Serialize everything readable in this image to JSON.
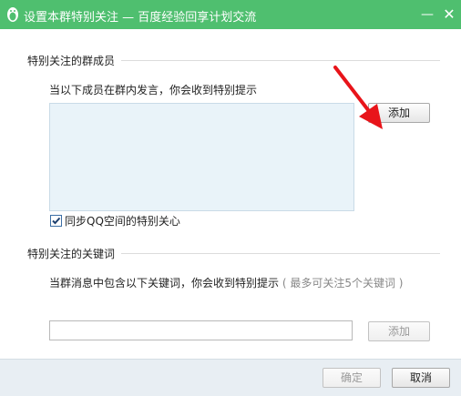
{
  "window": {
    "title": "设置本群特别关注 — 百度经验回享计划交流",
    "minimize_glyph": "—",
    "close_glyph": "✕"
  },
  "members_section": {
    "title": "特别关注的群成员",
    "hint": "当以下成员在群内发言，你会收到特别提示",
    "add_label": "添加",
    "sync_checkbox": {
      "label": "同步QQ空间的特别关心",
      "checked": true
    }
  },
  "keywords_section": {
    "title": "特别关注的关键词",
    "hint": "当群消息中包含以下关键词，你会收到特别提示",
    "hint_sub": "( 最多可关注5个关键词 )",
    "input_value": "",
    "add_label": "添加"
  },
  "footer": {
    "confirm_label": "确定",
    "cancel_label": "取消"
  },
  "colors": {
    "titlebar": "#4fbf6f",
    "member_box": "#e9f3f9",
    "footer": "#e8eef3",
    "annotation_arrow": "#e8141a"
  }
}
